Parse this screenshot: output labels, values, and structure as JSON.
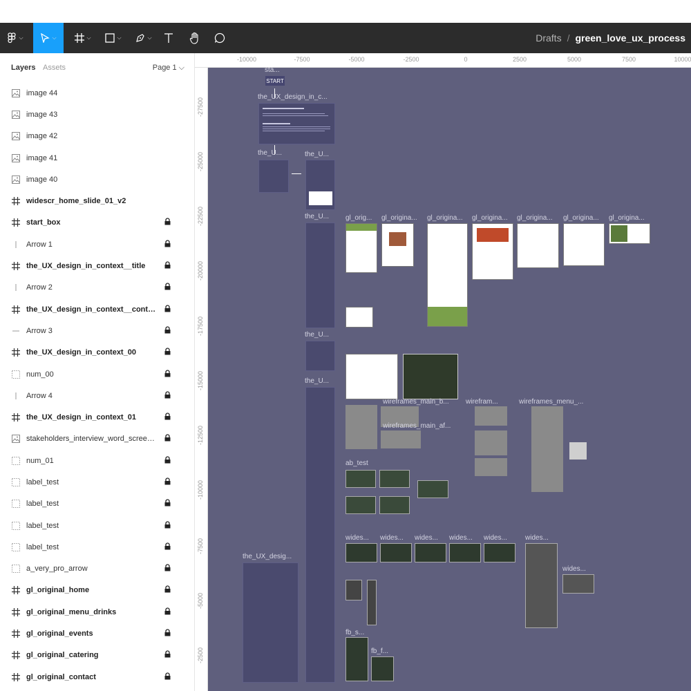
{
  "toolbar": {
    "tools": [
      {
        "name": "figma-menu-icon"
      },
      {
        "name": "move-tool-icon"
      },
      {
        "name": "frame-tool-icon"
      },
      {
        "name": "shape-tool-icon"
      },
      {
        "name": "pen-tool-icon"
      },
      {
        "name": "text-tool-icon"
      },
      {
        "name": "hand-tool-icon"
      },
      {
        "name": "comment-tool-icon"
      }
    ],
    "breadcrumb": {
      "drafts": "Drafts",
      "separator": "/",
      "file": "green_love_ux_process"
    }
  },
  "panel": {
    "tabs": {
      "layers": "Layers",
      "assets": "Assets"
    },
    "page_selector": "Page 1 ⌵",
    "layers": [
      {
        "name": "image 44",
        "type": "image",
        "locked": false
      },
      {
        "name": "image 43",
        "type": "image",
        "locked": false
      },
      {
        "name": "image 42",
        "type": "image",
        "locked": false
      },
      {
        "name": "image 41",
        "type": "image",
        "locked": false
      },
      {
        "name": "image 40",
        "type": "image",
        "locked": false
      },
      {
        "name": "widescr_home_slide_01_v2",
        "type": "frame",
        "locked": false
      },
      {
        "name": "start_box",
        "type": "frame",
        "locked": true
      },
      {
        "name": "Arrow 1",
        "type": "vline",
        "locked": true
      },
      {
        "name": "the_UX_design_in_context__title",
        "type": "frame",
        "locked": true
      },
      {
        "name": "Arrow 2",
        "type": "vline",
        "locked": true
      },
      {
        "name": "the_UX_design_in_context__contents",
        "type": "frame",
        "locked": true
      },
      {
        "name": "Arrow 3",
        "type": "hline",
        "locked": true
      },
      {
        "name": "the_UX_design_in_context_00",
        "type": "frame",
        "locked": true
      },
      {
        "name": "num_00",
        "type": "group",
        "locked": true
      },
      {
        "name": "Arrow 4",
        "type": "vline",
        "locked": true
      },
      {
        "name": "the_UX_design_in_context_01",
        "type": "frame",
        "locked": true
      },
      {
        "name": "stakeholders_interview_word_screen...",
        "type": "image",
        "locked": true
      },
      {
        "name": "num_01",
        "type": "group",
        "locked": true
      },
      {
        "name": "label_test",
        "type": "group",
        "locked": true
      },
      {
        "name": "label_test",
        "type": "group",
        "locked": true
      },
      {
        "name": "label_test",
        "type": "group",
        "locked": true
      },
      {
        "name": "label_test",
        "type": "group",
        "locked": true
      },
      {
        "name": "a_very_pro_arrow",
        "type": "group",
        "locked": true
      },
      {
        "name": "gl_original_home",
        "type": "frame",
        "locked": true
      },
      {
        "name": "gl_original_menu_drinks",
        "type": "frame",
        "locked": true
      },
      {
        "name": "gl_original_events",
        "type": "frame",
        "locked": true
      },
      {
        "name": "gl_original_catering",
        "type": "frame",
        "locked": true
      },
      {
        "name": "gl_original_contact",
        "type": "frame",
        "locked": true
      }
    ]
  },
  "canvas": {
    "ruler_top": [
      "-10000",
      "-7500",
      "-5000",
      "-2500",
      "0",
      "2500",
      "5000",
      "7500",
      "10000"
    ],
    "ruler_left": [
      "-27500",
      "-25000",
      "-22500",
      "-20000",
      "-17500",
      "-15000",
      "-12500",
      "-10000",
      "-7500",
      "-5000",
      "-2500"
    ],
    "frames": [
      {
        "key": "start",
        "label": "sta...",
        "text": "START"
      },
      {
        "key": "title",
        "label": "the_UX_design_in_c..."
      },
      {
        "key": "c1",
        "label": "the_U..."
      },
      {
        "key": "c2",
        "label": "the_U..."
      },
      {
        "key": "c3",
        "label": "the_U..."
      },
      {
        "key": "c4",
        "label": "the_U..."
      },
      {
        "key": "c5",
        "label": "the_U..."
      },
      {
        "key": "gl1",
        "label": "gl_orig..."
      },
      {
        "key": "gl2",
        "label": "gl_origina..."
      },
      {
        "key": "gl3",
        "label": "gl_origina..."
      },
      {
        "key": "gl4",
        "label": "gl_origina..."
      },
      {
        "key": "gl5",
        "label": "gl_origina..."
      },
      {
        "key": "gl6",
        "label": "gl_origina..."
      },
      {
        "key": "gl7",
        "label": "gl_origina..."
      },
      {
        "key": "wf1",
        "label": "wireframes_main_b..."
      },
      {
        "key": "wf2",
        "label": "wirefram..."
      },
      {
        "key": "wf3",
        "label": "wireframes_menu_..."
      },
      {
        "key": "wf4",
        "label": "wireframes_main_af..."
      },
      {
        "key": "ab",
        "label": "ab_test"
      },
      {
        "key": "w1",
        "label": "wides..."
      },
      {
        "key": "w2",
        "label": "wides..."
      },
      {
        "key": "w3",
        "label": "wides..."
      },
      {
        "key": "w4",
        "label": "wides..."
      },
      {
        "key": "w5",
        "label": "wides..."
      },
      {
        "key": "w6",
        "label": "wides..."
      },
      {
        "key": "w7",
        "label": "wides..."
      },
      {
        "key": "fb1",
        "label": "fb_s..."
      },
      {
        "key": "fb2",
        "label": "fb_f..."
      },
      {
        "key": "big",
        "label": "the_UX_desig..."
      }
    ]
  }
}
